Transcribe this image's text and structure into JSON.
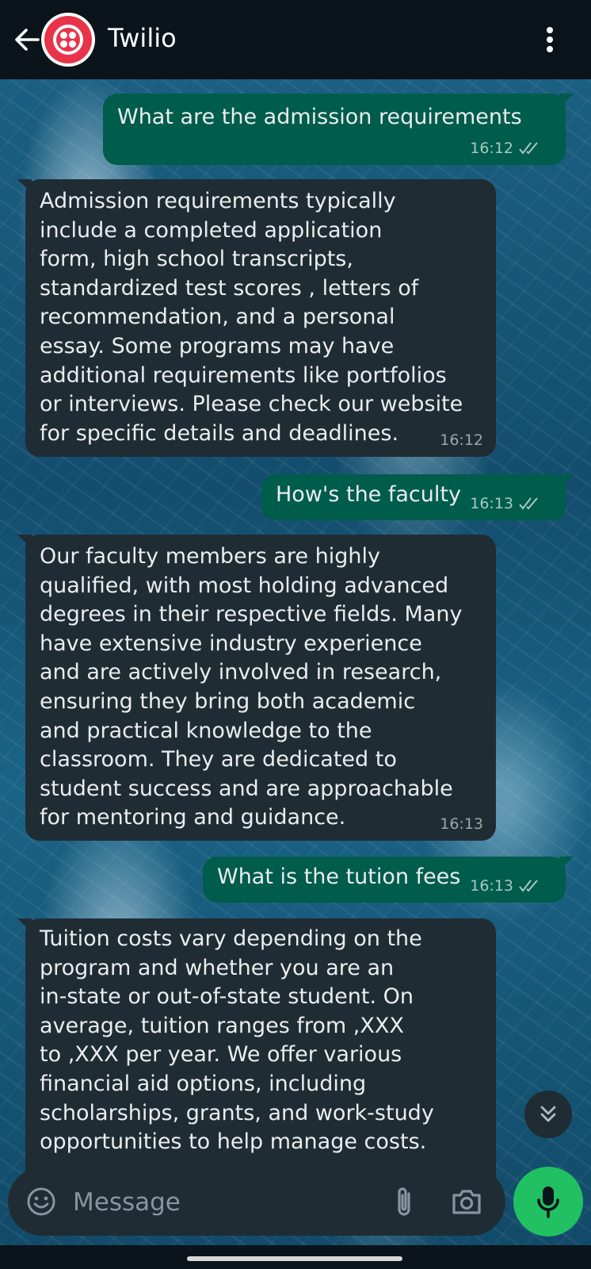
{
  "header": {
    "title": "Twilio",
    "back_icon": "arrow-left-icon",
    "avatar_icon": "twilio-logo",
    "menu_icon": "more-vertical-icon"
  },
  "messages": [
    {
      "direction": "outgoing",
      "text": "What are the admission requirements",
      "time": "16:12",
      "status": "read"
    },
    {
      "direction": "incoming",
      "text": "Admission requirements typically\ninclude a completed application\nform, high school transcripts,\nstandardized test scores , letters of\nrecommendation, and a personal\nessay. Some programs may have\nadditional requirements like portfolios\nor interviews. Please check our website\nfor specific details and deadlines.",
      "time": "16:12"
    },
    {
      "direction": "outgoing",
      "text": "How's the faculty",
      "time": "16:13",
      "status": "read"
    },
    {
      "direction": "incoming",
      "text": "Our faculty members are highly\nqualified, with most holding advanced\ndegrees in their respective fields. Many\nhave extensive industry experience\nand are actively involved in research,\nensuring they bring both academic\nand practical knowledge to the\nclassroom. They are dedicated to\nstudent success and are approachable\nfor mentoring and guidance.",
      "time": "16:13"
    },
    {
      "direction": "outgoing",
      "text": "What is the tution fees",
      "time": "16:13",
      "status": "read"
    },
    {
      "direction": "incoming",
      "text": "Tuition costs vary depending on the\nprogram and whether you are an\nin-state or out-of-state student. On\naverage, tuition ranges from ,XXX\nto ,XXX per year. We offer various\nfinancial aid options, including\nscholarships, grants, and work-study\nopportunities to help manage costs.",
      "time": ""
    }
  ],
  "scroll_down_icon": "chevrons-down-icon",
  "composer": {
    "placeholder": "Message",
    "value": "",
    "emoji_icon": "emoji-icon",
    "attach_icon": "paperclip-icon",
    "camera_icon": "camera-icon",
    "mic_icon": "microphone-icon"
  },
  "colors": {
    "header_bg": "#0b141a",
    "outgoing_bubble": "#005c4b",
    "incoming_bubble": "#202c33",
    "mic_button": "#21c063",
    "brand_red": "#e8344b",
    "text": "#e9edef"
  }
}
